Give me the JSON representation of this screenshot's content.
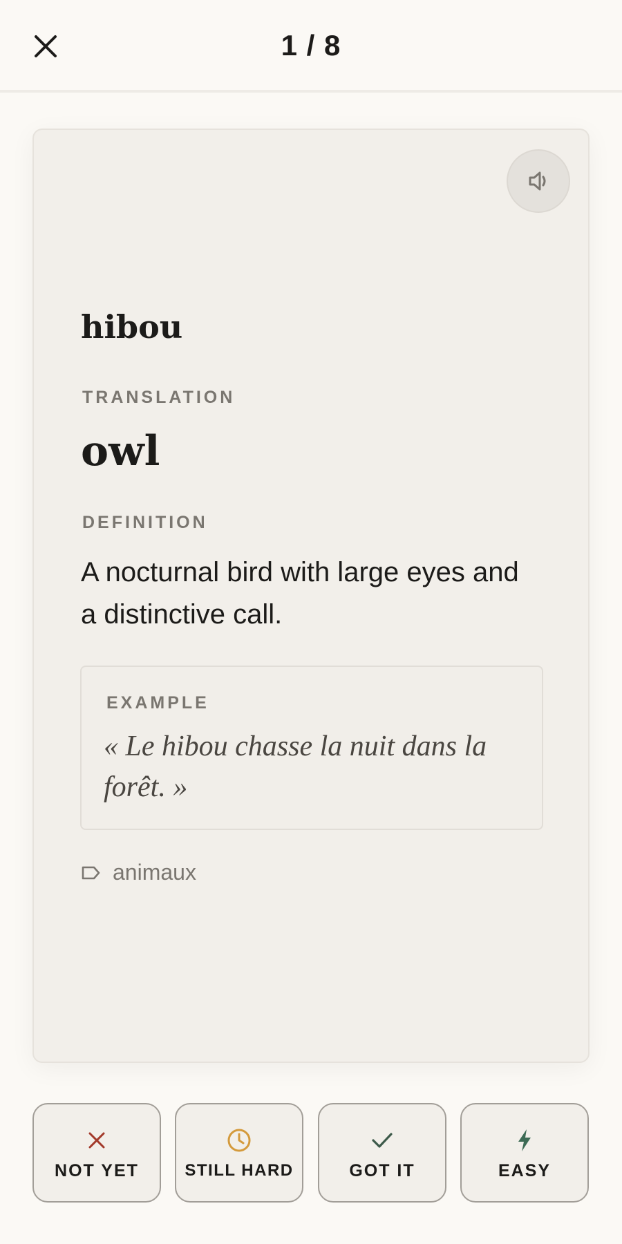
{
  "header": {
    "progress": "1 / 8",
    "close_icon": "close-icon"
  },
  "card": {
    "audio_icon": "speaker-icon",
    "word": "hibou",
    "translation_label": "TRANSLATION",
    "translation": "owl",
    "definition_label": "DEFINITION",
    "definition": "A nocturnal bird with large eyes and a distinctive call.",
    "example_label": "EXAMPLE",
    "example": "« Le hibou chasse la nuit dans la forêt. »",
    "tag_icon": "tag-icon",
    "tag": "animaux"
  },
  "actions": [
    {
      "label": "NOT YET",
      "icon": "x-icon",
      "color": "#a33a2b"
    },
    {
      "label": "STILL HARD",
      "icon": "clock-icon",
      "color": "#d49a3c"
    },
    {
      "label": "GOT IT",
      "icon": "check-icon",
      "color": "#3d5a4a"
    },
    {
      "label": "EASY",
      "icon": "bolt-icon",
      "color": "#3d6b55"
    }
  ],
  "colors": {
    "background": "#fbf9f5",
    "card": "#f2efea",
    "text": "#1c1b19",
    "muted": "#7a7670"
  }
}
